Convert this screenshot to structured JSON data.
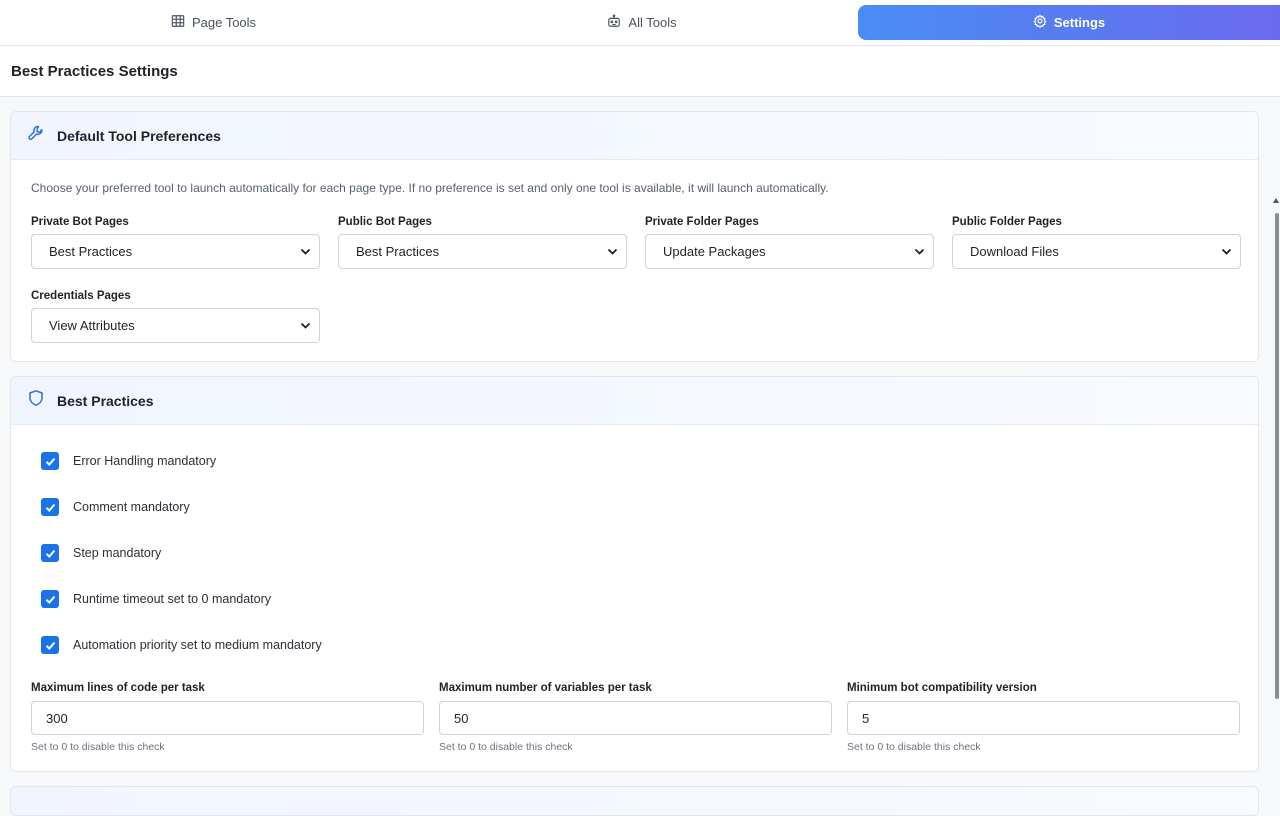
{
  "tabs": [
    {
      "label": "Page Tools",
      "icon": "table-icon"
    },
    {
      "label": "All Tools",
      "icon": "robot-icon"
    },
    {
      "label": "Settings",
      "icon": "gear-icon",
      "active": true
    }
  ],
  "page_title": "Best Practices Settings",
  "default_prefs": {
    "title": "Default Tool Preferences",
    "icon": "wrench-icon",
    "description": "Choose your preferred tool to launch automatically for each page type. If no preference is set and only one tool is available, it will launch automatically.",
    "fields": [
      {
        "label": "Private Bot Pages",
        "value": "Best Practices"
      },
      {
        "label": "Public Bot Pages",
        "value": "Best Practices"
      },
      {
        "label": "Private Folder Pages",
        "value": "Update Packages"
      },
      {
        "label": "Public Folder Pages",
        "value": "Download Files"
      },
      {
        "label": "Credentials Pages",
        "value": "View Attributes"
      }
    ]
  },
  "best_practices": {
    "title": "Best Practices",
    "icon": "shield-icon",
    "checks": [
      {
        "label": "Error Handling mandatory",
        "checked": true
      },
      {
        "label": "Comment mandatory",
        "checked": true
      },
      {
        "label": "Step mandatory",
        "checked": true
      },
      {
        "label": "Runtime timeout set to 0 mandatory",
        "checked": true
      },
      {
        "label": "Automation priority set to medium mandatory",
        "checked": true
      }
    ],
    "numbers": [
      {
        "label": "Maximum lines of code per task",
        "value": "300",
        "hint": "Set to 0 to disable this check"
      },
      {
        "label": "Maximum number of variables per task",
        "value": "50",
        "hint": "Set to 0 to disable this check"
      },
      {
        "label": "Minimum bot compatibility version",
        "value": "5",
        "hint": "Set to 0 to disable this check"
      }
    ]
  },
  "colors": {
    "accent": "#1a73e8",
    "tab_gradient_start": "#4a8df5",
    "tab_gradient_end": "#6c6aee"
  }
}
